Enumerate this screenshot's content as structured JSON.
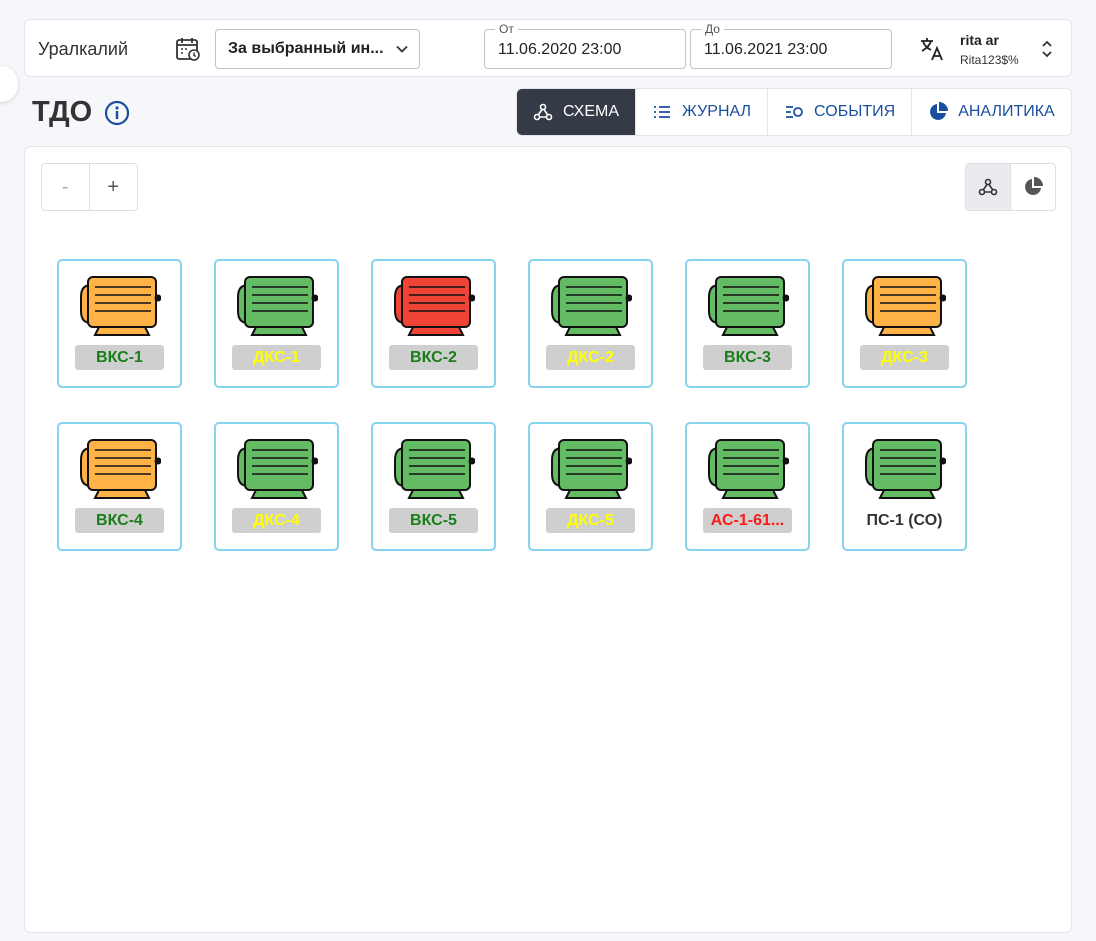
{
  "header": {
    "company": "Уралкалий",
    "period_select": "За выбранный ин...",
    "date_from_label": "От",
    "date_from": "11.06.2020 23:00",
    "date_to_label": "До",
    "date_to": "11.06.2021 23:00",
    "user_name": "rita ar",
    "user_login": "Rita123$%"
  },
  "page": {
    "title": "ТДО"
  },
  "tabs": [
    {
      "label": "СХЕМА",
      "icon": "schema-icon",
      "active": true
    },
    {
      "label": "ЖУРНАЛ",
      "icon": "list-icon",
      "active": false
    },
    {
      "label": "СОБЫТИЯ",
      "icon": "events-icon",
      "active": false
    },
    {
      "label": "АНАЛИТИКА",
      "icon": "pie-chart-icon",
      "active": false
    }
  ],
  "zoom": {
    "minus": "-",
    "plus": "+"
  },
  "colors": {
    "orange": "#ffb347",
    "green": "#63bb63",
    "red": "#f04438",
    "label_green": "#1a7f1a",
    "label_yellow": "#ffff00",
    "label_red": "#ff1a1a",
    "label_dark": "#333333",
    "active_tab": "#343a46",
    "link_blue": "#1a4fa0"
  },
  "devices": [
    {
      "label": "ВКС-1",
      "state": "orange",
      "label_color": "green"
    },
    {
      "label": "ДКС-1",
      "state": "green",
      "label_color": "yellow"
    },
    {
      "label": "ВКС-2",
      "state": "red",
      "label_color": "green"
    },
    {
      "label": "ДКС-2",
      "state": "green",
      "label_color": "yellow"
    },
    {
      "label": "ВКС-3",
      "state": "green",
      "label_color": "green"
    },
    {
      "label": "ДКС-3",
      "state": "orange",
      "label_color": "yellow"
    },
    {
      "label": "ВКС-4",
      "state": "orange",
      "label_color": "green"
    },
    {
      "label": "ДКС-4",
      "state": "green",
      "label_color": "yellow"
    },
    {
      "label": "ВКС-5",
      "state": "green",
      "label_color": "green"
    },
    {
      "label": "ДКС-5",
      "state": "green",
      "label_color": "yellow"
    },
    {
      "label": "АС-1-61...",
      "state": "green",
      "label_color": "red"
    },
    {
      "label": "ПС-1 (СО)",
      "state": "green",
      "label_color": "dark",
      "plain": true
    }
  ]
}
